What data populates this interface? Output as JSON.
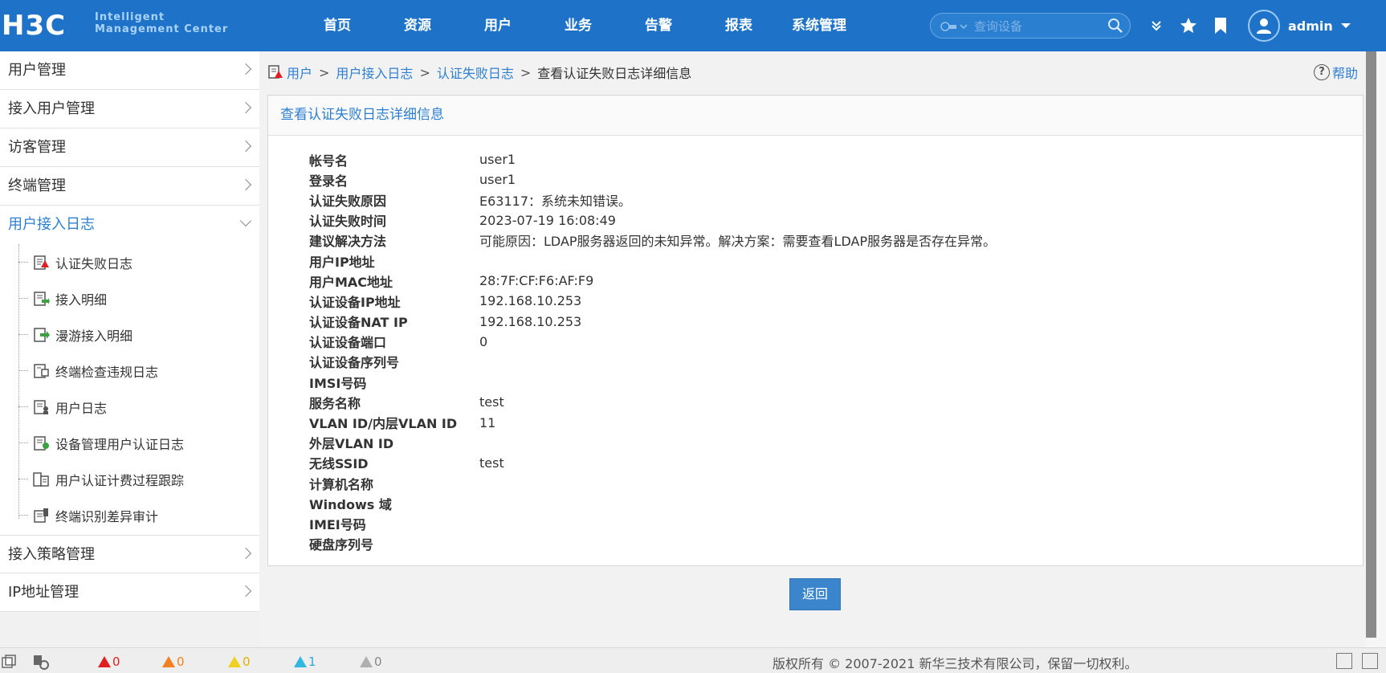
{
  "app": {
    "logo_main": "H3C",
    "logo_line1": "Intelligent",
    "logo_line2": "Management Center"
  },
  "nav": [
    "首页",
    "资源",
    "用户",
    "业务",
    "告警",
    "报表",
    "系统管理"
  ],
  "search": {
    "placeholder": "查询设备"
  },
  "user": {
    "name": "admin"
  },
  "sidebar": {
    "items": [
      {
        "label": "用户管理"
      },
      {
        "label": "接入用户管理"
      },
      {
        "label": "访客管理"
      },
      {
        "label": "终端管理"
      },
      {
        "label": "用户接入日志"
      },
      {
        "label": "接入策略管理"
      },
      {
        "label": "IP地址管理"
      }
    ],
    "sub_items": [
      {
        "label": "认证失败日志",
        "icon": "auth-fail-log-icon"
      },
      {
        "label": "接入明细",
        "icon": "access-detail-icon"
      },
      {
        "label": "漫游接入明细",
        "icon": "roaming-access-icon"
      },
      {
        "label": "终端检查违规日志",
        "icon": "terminal-check-icon"
      },
      {
        "label": "用户日志",
        "icon": "user-log-icon"
      },
      {
        "label": "设备管理用户认证日志",
        "icon": "device-auth-log-icon"
      },
      {
        "label": "用户认证计费过程跟踪",
        "icon": "auth-trace-icon"
      },
      {
        "label": "终端识别差异审计",
        "icon": "terminal-audit-icon"
      }
    ]
  },
  "breadcrumb": {
    "items": [
      "用户",
      "用户接入日志",
      "认证失败日志"
    ],
    "separator": ">",
    "current": "查看认证失败日志详细信息"
  },
  "help": {
    "label": "帮助"
  },
  "panel": {
    "title": "查看认证失败日志详细信息",
    "rows": [
      {
        "k": "帐号名",
        "v": "user1"
      },
      {
        "k": "登录名",
        "v": "user1"
      },
      {
        "k": "认证失败原因",
        "v": "E63117：系统未知错误。"
      },
      {
        "k": "认证失败时间",
        "v": "2023-07-19 16:08:49"
      },
      {
        "k": "建议解决方法",
        "v": "可能原因：LDAP服务器返回的未知异常。解决方案：需要查看LDAP服务器是否存在异常。"
      },
      {
        "k": "用户IP地址",
        "v": ""
      },
      {
        "k": "用户MAC地址",
        "v": "28:7F:CF:F6:AF:F9"
      },
      {
        "k": "认证设备IP地址",
        "v": "192.168.10.253"
      },
      {
        "k": "认证设备NAT IP",
        "v": "192.168.10.253"
      },
      {
        "k": "认证设备端口",
        "v": "0"
      },
      {
        "k": "认证设备序列号",
        "v": ""
      },
      {
        "k": "IMSI号码",
        "v": ""
      },
      {
        "k": "服务名称",
        "v": "test"
      },
      {
        "k": "VLAN ID/内层VLAN ID",
        "v": "11"
      },
      {
        "k": "外层VLAN ID",
        "v": ""
      },
      {
        "k": "无线SSID",
        "v": "test"
      },
      {
        "k": "计算机名称",
        "v": ""
      },
      {
        "k": "Windows 域",
        "v": ""
      },
      {
        "k": "IMEI号码",
        "v": ""
      },
      {
        "k": "硬盘序列号",
        "v": ""
      }
    ],
    "back_label": "返回"
  },
  "footer": {
    "alarms": [
      {
        "count": "0",
        "color": "#e02020"
      },
      {
        "count": "0",
        "color": "#f08020"
      },
      {
        "count": "0",
        "color": "#f0d020"
      },
      {
        "count": "1",
        "color": "#30b8e0"
      },
      {
        "count": "0",
        "color": "#b0b0b0"
      }
    ],
    "copyright": "版权所有 © 2007-2021 新华三技术有限公司，保留一切权利。"
  },
  "colors": {
    "topbar": "#1e73c8",
    "link": "#2d7fd1",
    "button": "#3a85cc"
  }
}
